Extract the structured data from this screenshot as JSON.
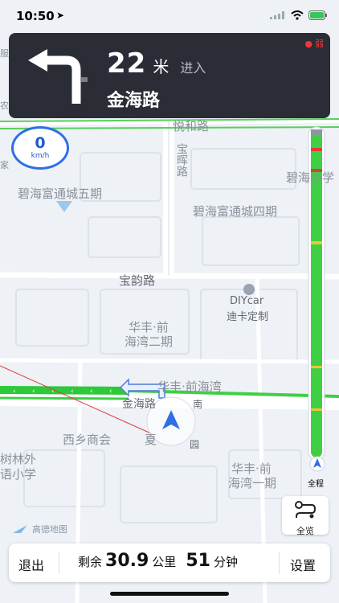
{
  "status_bar": {
    "time": "10:50"
  },
  "nav": {
    "distance": "22",
    "unit": "米",
    "action": "进入",
    "road": "金海路",
    "gps_signal": "弱"
  },
  "speed": {
    "value": "0",
    "unit": "km/h"
  },
  "map_labels": {
    "yuehe": "悦和路",
    "baohui": "宝晖路",
    "bihai5": "碧海富通城五期",
    "bihai4": "碧海富通城四期",
    "bihaixue": "碧海小学",
    "baoyun": "宝韵路",
    "diycar": "DIYcar",
    "diyke": "迪卡定制",
    "huafeng2_a": "华丰·前",
    "huafeng2_b": "海湾二期",
    "huafeng_road": "华丰·前海湾",
    "jinhai": "金海路",
    "xixiang": "西乡商会",
    "xia": "夏",
    "huafeng1_a": "华丰·前",
    "huafeng1_b": "海湾一期",
    "shulin": "树林外",
    "yuxiao": "语小学",
    "road_east_1": "南",
    "road_east_2": "园",
    "left_cut_1": "家",
    "left_cut_2": "农",
    "left_cut_3": "服"
  },
  "overview_label": "全程",
  "full_view_label": "全览",
  "logo_text": "高德地图",
  "bottom_bar": {
    "exit": "退出",
    "remain_prefix": "剩余",
    "distance": "30.9",
    "distance_unit": "公里",
    "time": "51",
    "time_unit": "分钟",
    "settings": "设置"
  },
  "colors": {
    "nav_bg": "#2a2c36",
    "route_green": "#3fcf45",
    "route_red": "#e23b3b",
    "route_yellow": "#f1c531",
    "accent_blue": "#2f6fe6"
  }
}
